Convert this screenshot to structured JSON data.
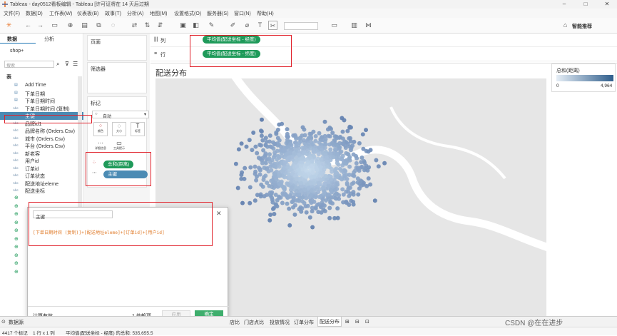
{
  "window": {
    "title": "Tableau - day0512看板编辑 - Tableau [许可证将在 14 天后过期"
  },
  "menu": [
    "文件(F)",
    "数据(D)",
    "工作表(W)",
    "仪表板(B)",
    "故事(T)",
    "分析(A)",
    "地图(M)",
    "设置格式(O)",
    "服务器(S)",
    "窗口(N)",
    "帮助(H)"
  ],
  "toolbar": {
    "show_me": "智能推荐"
  },
  "data_pane": {
    "tabs": [
      "数据",
      "分析"
    ],
    "datasource": "shop+",
    "search_placeholder": "搜索",
    "section": "表",
    "fields": [
      {
        "type": "date",
        "name": "Add Time"
      },
      {
        "type": "date",
        "name": "下单日期"
      },
      {
        "type": "date",
        "name": "下单日期时间"
      },
      {
        "type": "abc",
        "name": "下单日期时间 (复制)"
      },
      {
        "type": "abc",
        "name": "主键"
      },
      {
        "type": "abc",
        "name": "品牌id1"
      },
      {
        "type": "abc",
        "name": "品牌名称 (Orders.Csv)"
      },
      {
        "type": "abc",
        "name": "城市 (Orders.Csv)"
      },
      {
        "type": "abc",
        "name": "平台 (Orders.Csv)"
      },
      {
        "type": "abc",
        "name": "新老客"
      },
      {
        "type": "abc",
        "name": "用户id"
      },
      {
        "type": "abc",
        "name": "订单id"
      },
      {
        "type": "abc",
        "name": "订单状态"
      },
      {
        "type": "abc",
        "name": "配送地址eleme"
      },
      {
        "type": "abc",
        "name": "配送坐标"
      }
    ],
    "geo_icon_count": 10
  },
  "cards": {
    "pages": "页面",
    "filters": "筛选器",
    "marks": "标记",
    "mark_type": "自动",
    "mark_buttons": [
      "颜色",
      "大小",
      "标签",
      "详细信息",
      "工具提示"
    ],
    "mark_fields": [
      {
        "icon": "color",
        "label": "总和(距离)"
      },
      {
        "icon": "detail",
        "label": "主键"
      }
    ]
  },
  "shelves": {
    "columns_label": "列",
    "rows_label": "行",
    "columns_pill": "平均值(配送坐标 - 经度)",
    "rows_pill": "平均值(配送坐标 - 纬度)"
  },
  "view": {
    "title": "配送分布",
    "legend_title": "总和(距离)",
    "legend_min": "0",
    "legend_max": "4,964",
    "legend_color_start": "#e6eef6",
    "legend_color_end": "#2f5e8c",
    "point_color": "#4b7eae",
    "water_color": "#ffffff",
    "land_color": "#e6e6e6"
  },
  "calc_dialog": {
    "name": "主键",
    "formula": "[下单日期时间 (复制)]+[配送地址eleme]+[订单id]+[用户id]",
    "status": "计算有效。",
    "dependency": "1 依赖项",
    "apply_label": "应用",
    "ok_label": "确定"
  },
  "bottom": {
    "datasource_tab": "数据源",
    "sheet_tabs": [
      "店比",
      "门店点比",
      "投放情况",
      "订单分布",
      "配送分布"
    ],
    "active_tab": "配送分布",
    "status_marks": "4417 个标记",
    "status_rows": "1 行 x 1 列",
    "status_sum": "平均值(配送坐标 - 经度) 的总和: 535,655.5"
  },
  "watermark": "CSDN @在在进步"
}
